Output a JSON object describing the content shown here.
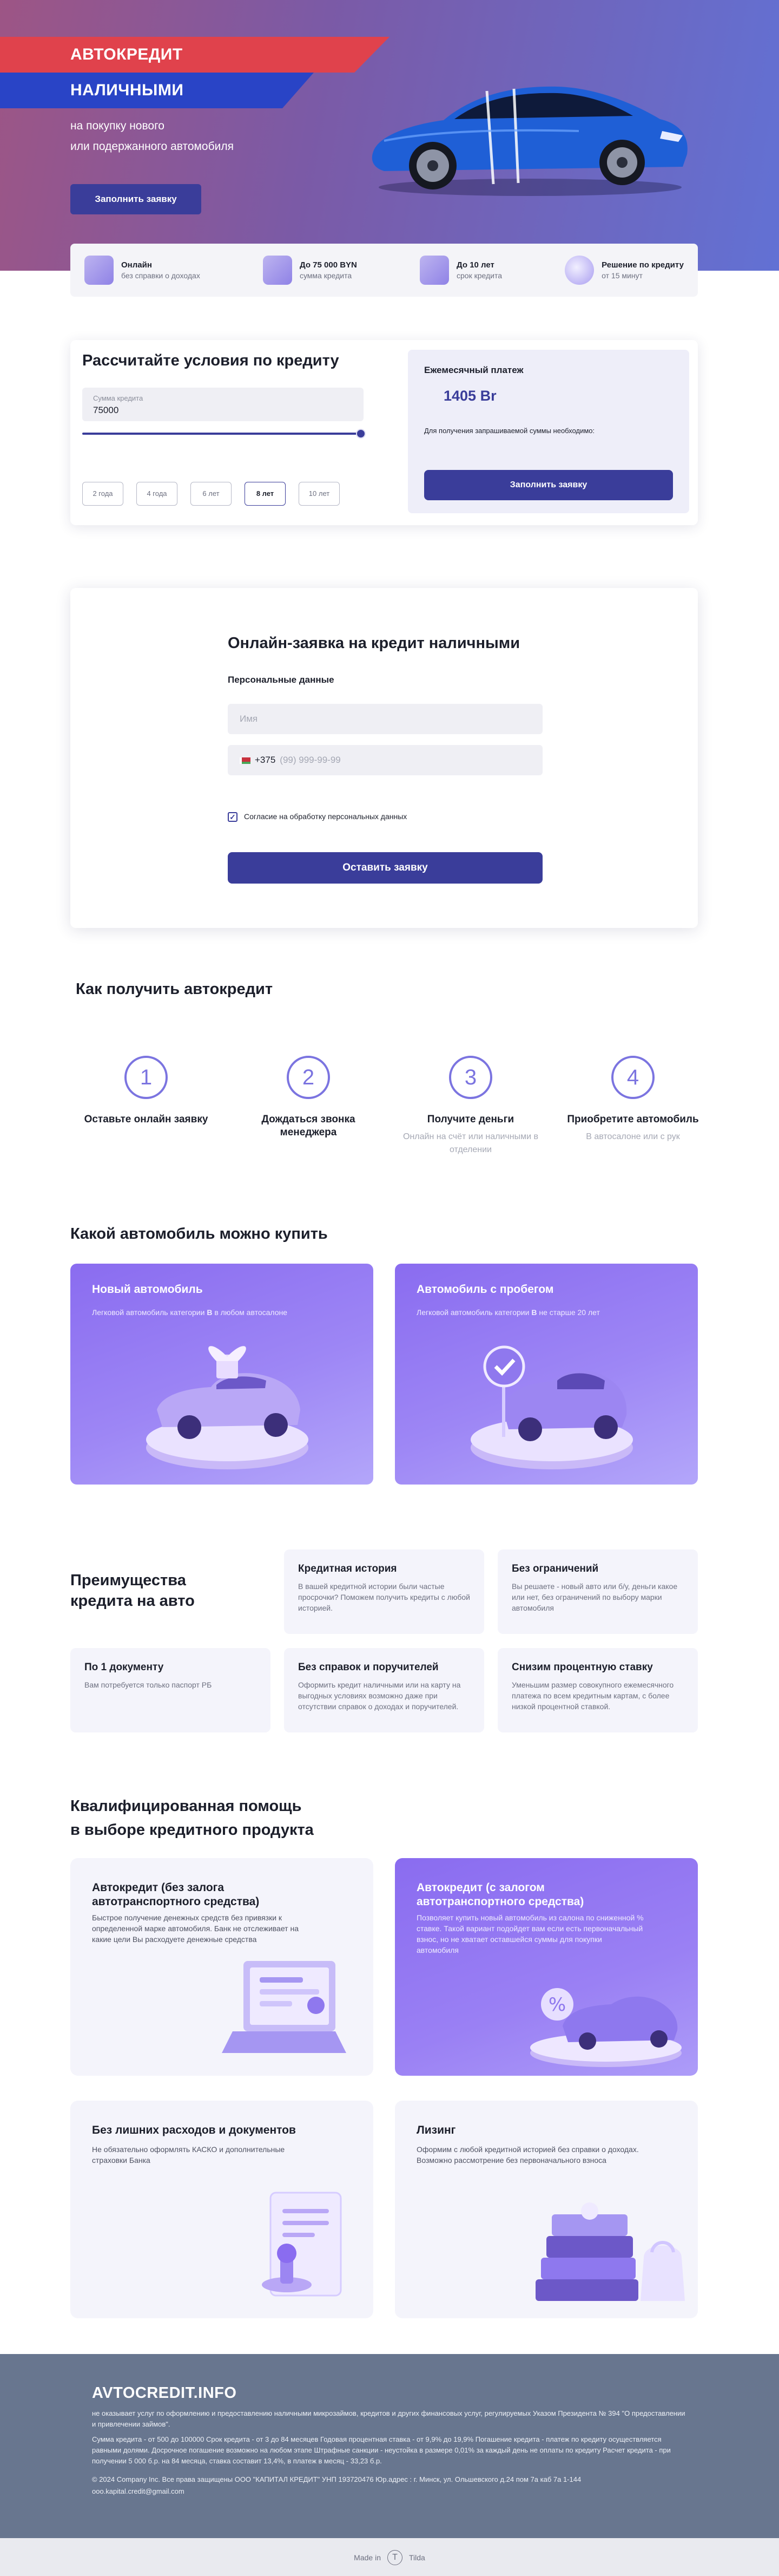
{
  "hero": {
    "title_line1": "АВТОКРЕДИТ",
    "title_line2": "НАЛИЧНЫМИ",
    "subtitle_line1": "на покупку нового",
    "subtitle_line2": "или подержанного автомобиля",
    "cta": "Заполнить заявку"
  },
  "features": [
    {
      "title": "Онлайн",
      "text": "без справки о доходах",
      "icon": "online-icon"
    },
    {
      "title": "До 75 000 BYN",
      "text": "сумма кредита",
      "icon": "money-box-icon"
    },
    {
      "title": "До 10 лет",
      "text": "срок кредита",
      "icon": "calendar-icon"
    },
    {
      "title": "Решение по кредиту",
      "text": "от 15 минут",
      "icon": "clock-icon"
    }
  ],
  "calculator": {
    "title": "Рассчитайте условия по кредиту",
    "amount_label": "Сумма кредита",
    "amount_value": "75000",
    "slider_fraction": 1.0,
    "terms": [
      "2 года",
      "4 года",
      "6 лет",
      "8 лет",
      "10 лет"
    ],
    "active_term": "8 лет",
    "result_label": "Ежемесячный платеж",
    "result_value": "1405 Br",
    "result_note": "Для получения запрашиваемой суммы необходимо:",
    "result_button": "Заполнить заявку"
  },
  "form": {
    "title": "Онлайн-заявка на кредит наличными",
    "section": "Персональные данные",
    "name_placeholder": "Имя",
    "phone_code": "+375",
    "phone_placeholder": "(99) 999-99-99",
    "consent": "Согласие на обработку персональных данных",
    "consent_checked": true,
    "submit": "Оставить заявку"
  },
  "steps": {
    "title": "Как получить автокредит",
    "items": [
      {
        "num": "1",
        "title": "Оставьте онлайн заявку",
        "text": ""
      },
      {
        "num": "2",
        "title": "Дождаться звонка менеджера",
        "text": ""
      },
      {
        "num": "3",
        "title": "Получите деньги",
        "text": "Онлайн на счёт или наличными в отделении"
      },
      {
        "num": "4",
        "title": "Приобретите автомобиль",
        "text": "В автосалоне или с рук"
      }
    ]
  },
  "car_types": {
    "title": "Какой автомобиль можно купить",
    "new": {
      "title": "Новый автомобиль",
      "text_pre": "Легковой автомобиль категории ",
      "text_bold": "B",
      "text_post": " в любом автосалоне"
    },
    "used": {
      "title": "Автомобиль с пробегом",
      "text_pre": "Легковой автомобиль категории ",
      "text_bold": "B",
      "text_post": " не старше 20 лет"
    }
  },
  "advantages": {
    "title_line1": "Преимущества",
    "title_line2": "кредита на авто",
    "items": [
      {
        "title": "Кредитная история",
        "text": "В вашей кредитной истории были частые просрочки? Поможем получить кредиты с любой историей."
      },
      {
        "title": "Без ограничений",
        "text": "Вы решаете - новый авто или б/у, деньги какое или нет, без ограничений по выбору марки автомобиля"
      },
      {
        "title": "По 1 документу",
        "text": "Вам потребуется только паспорт РБ"
      },
      {
        "title": "Без справок и поручителей",
        "text": "Оформить кредит наличными или на карту на выгодных условиях возможно даже при отсутствии справок о доходах и поручителей."
      },
      {
        "title": "Снизим процентную ставку",
        "text": "Уменьшим размер совокупного ежемесячного платежа по всем кредитным картам, с более низкой процентной ставкой."
      }
    ]
  },
  "help": {
    "title_line1": "Квалифицированная помощь",
    "title_line2": "в выборе кредитного продукта",
    "cards": [
      {
        "title": "Автокредит (без залога автотранспортного средства)",
        "text": "Быстрое получение денежных средств без привязки к определенной марке автомобиля. Банк не отслеживает на какие цели Вы расходуете денежные средства"
      },
      {
        "title": "Автокредит (с залогом автотранспортного средства)",
        "text": "Позволяет купить новый автомобиль из салона по сниженной % ставке. Такой вариант подойдет вам если есть первоначальный взнос, но не хватает оставшейся суммы для покупки автомобиля"
      },
      {
        "title": "Без лишних расходов и документов",
        "text": "Не обязательно оформлять КАСКО и дополнительные страховки Банка"
      },
      {
        "title": "Лизинг",
        "text": "Оформим с любой кредитной историей без справки о доходах. Возможно рассмотрение без первоначального взноса"
      }
    ]
  },
  "footer": {
    "logo": "AVTOCREDIT.INFO",
    "p1": "не оказывает услуг по оформлению и предоставлению наличными микрозаймов, кредитов и других финансовых услуг, регулируемых Указом Президента № 394 \"О предоставлении и привлечении займов\".",
    "p2": "Сумма кредита - от 500 до 100000 Срок кредита - от 3 до 84 месяцев Годовая процентная ставка - от 9,9% до 19,9% Погашение кредита - платеж по кредиту осуществляется равными долями. Досрочное погашение возможно на любом этапе Штрафные санкции - неустойка в размере 0,01% за каждый день не оплаты по кредиту Расчет кредита - при получении 5 000 б.р. на 84 месяца, ставка составит 13,4%, в платеж в месяц - 33,23 б.р.",
    "p3": "© 2024 Company Inc. Все права защищены ООО \"КАПИТАЛ КРЕДИТ\" УНП 193720476 Юр.адрес : г. Минск, ул. Ольшевского д.24 пом 7а каб 7а 1-144",
    "p4": "ooo.kapital.credit@gmail.com",
    "made_in": "Made in",
    "made_brand": "Tilda"
  },
  "colors": {
    "accent": "#3a3d9a",
    "red_band": "#e0424c",
    "blue_band": "#2944c6",
    "purple": "#8a6cf0",
    "footer": "#68768f"
  }
}
